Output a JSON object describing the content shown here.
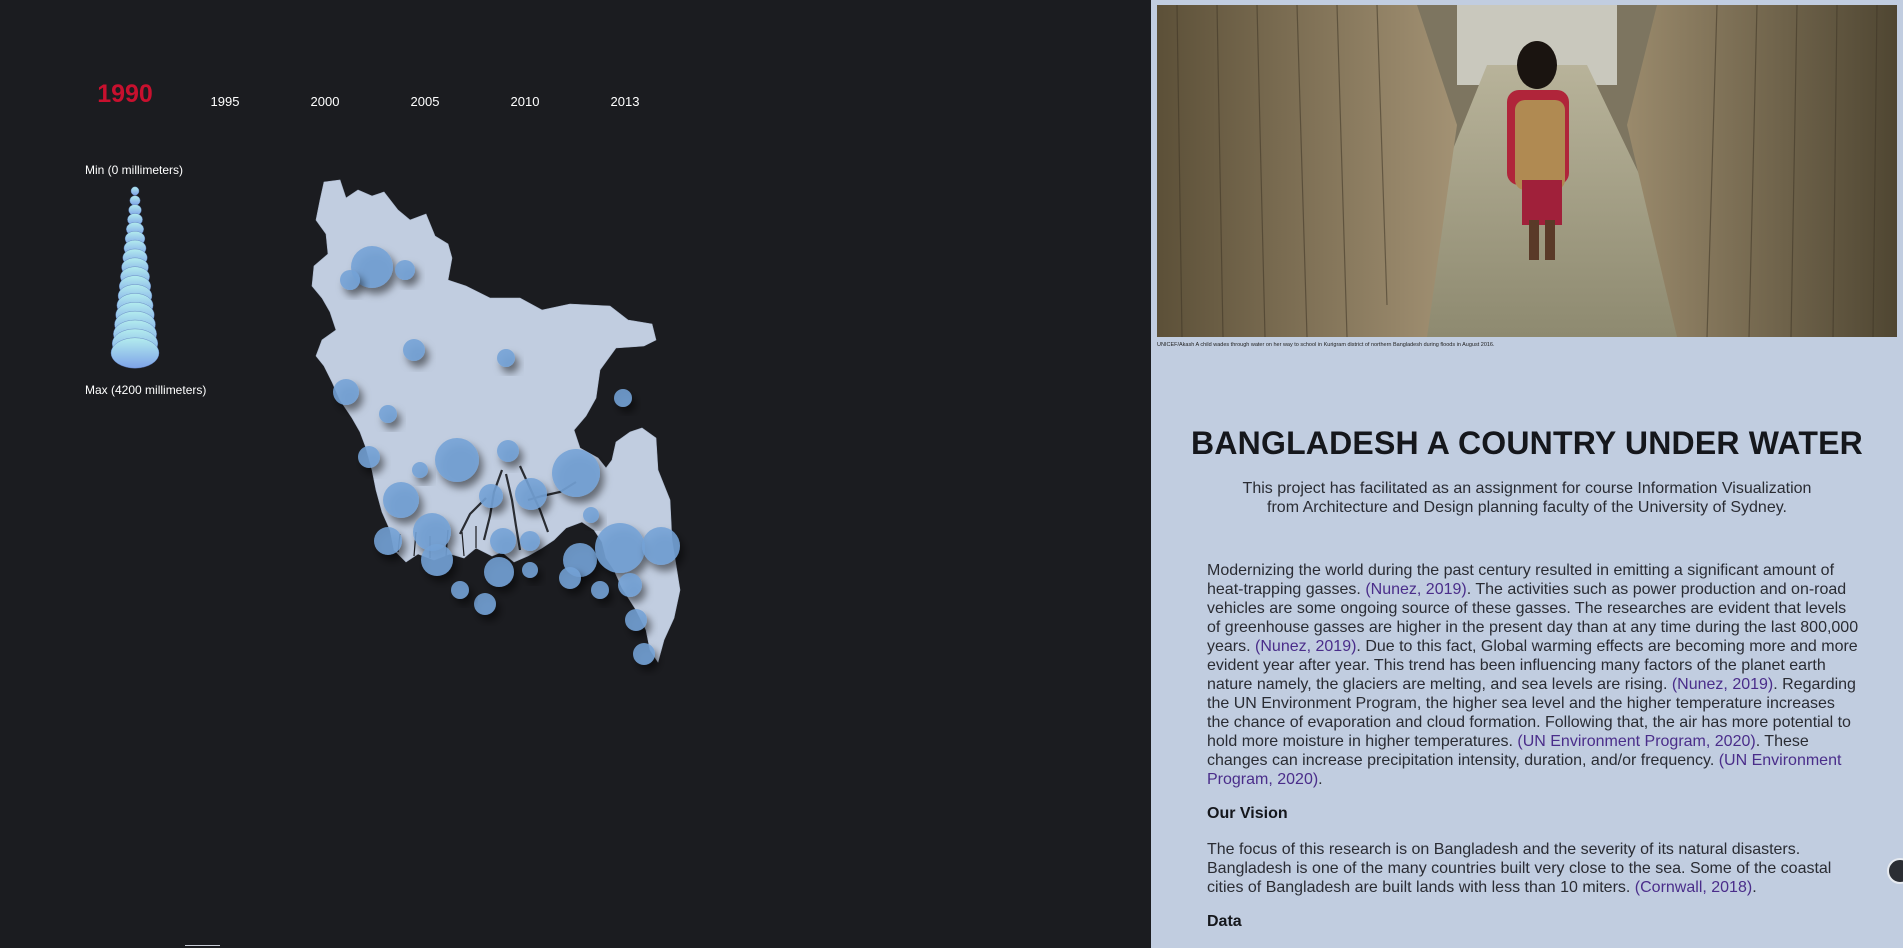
{
  "timeline": {
    "active_year": "1990",
    "years": [
      "1990",
      "1995",
      "2000",
      "2005",
      "2010",
      "2013"
    ]
  },
  "legend": {
    "min_label": "Min (0 millimeters)",
    "max_label": "Max (4200 millimeters)",
    "min_color": "#b3ecee",
    "max_color": "#7ea3e8"
  },
  "map": {
    "country": "Bangladesh",
    "land_color": "#c1cde0",
    "bubble_color": "#74a2d6",
    "bubble_count": 34
  },
  "article": {
    "photo_caption": "UNICEF/Akash A child wades through water on her way to school in Kurigram district of northern Bangladesh during floods in August 2016.",
    "title": "BANGLADESH A COUNTRY UNDER WATER",
    "intro": "This project has facilitated as an assignment for course Information Visualization from Architecture and Design planning faculty of the University of Sydney.",
    "p1": {
      "s1": "Modernizing the world during the past century resulted in emitting a significant amount of heat-trapping gasses.",
      "c1": "(Nunez, 2019)",
      "s2": ". The activities such as power production and on-road vehicles are some ongoing source of these gasses. The researches are evident that levels of greenhouse gasses are higher in the present day than at any time during the last 800,000 years.",
      "c2": "(Nunez, 2019)",
      "s3": ". Due to this fact, Global warming effects are becoming more and more evident year after year. This trend has been influencing many factors of the planet earth nature namely, the glaciers are melting, and sea levels are rising.",
      "c3": "(Nunez, 2019)",
      "s4": ". Regarding the UN Environment Program, the higher sea level and the higher temperature increases the chance of evaporation and cloud formation. Following that, the air has more potential to hold more moisture in higher temperatures.",
      "c4": "(UN Environment Program, 2020)",
      "s5": ". These changes can increase precipitation intensity, duration, and/or frequency.",
      "c5": "(UN Environment Program, 2020)",
      "s6": "."
    },
    "vision_heading": "Our Vision",
    "vision": {
      "s1": "The focus of this research is on Bangladesh and the severity of its natural disasters. Bangladesh is one of the many countries built very close to the sea. Some of the coastal cities of Bangladesh are built lands with less than 10 miters.",
      "c1": "(Cornwall, 2018)",
      "s2": "."
    },
    "data_heading": "Data"
  }
}
